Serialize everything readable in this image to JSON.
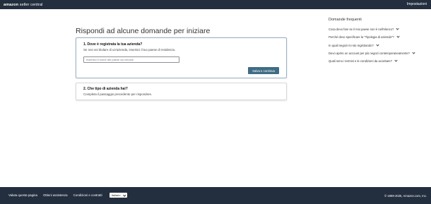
{
  "header": {
    "logo_brand": "amazon",
    "logo_product": "seller central",
    "settings_label": "Impostazioni"
  },
  "main": {
    "title": "Rispondi ad alcune domande per iniziare",
    "step1": {
      "title": "1. Dove è registrata la tua azienda?",
      "subtitle": "Se non sei titolare di un'azienda, inserisci il tuo paese di residenza.",
      "input_placeholder": "Inserisci il nome del paese da cercare",
      "input_value": "",
      "button_label": "Salva e continua"
    },
    "step2": {
      "title": "2. Che tipo di azienda hai?",
      "subtitle": "Completa il passaggio precedente per rispondere."
    }
  },
  "faq": {
    "title": "Domande frequenti",
    "items": [
      {
        "label": "Cosa devo fare se il mio paese non è nell'elenco?"
      },
      {
        "label": "Perché devo specificare la \"Tipologia di azienda\"?"
      },
      {
        "label": "In quali negozi mi sto registrando?"
      },
      {
        "label": "Devo aprire un account per più negozi contemporaneamente?"
      },
      {
        "label": "Quali sono i termini e le condizioni da accettare?"
      }
    ]
  },
  "footer": {
    "links": [
      {
        "label": "Valuta questa pagina"
      },
      {
        "label": "Ottieni assistenza"
      },
      {
        "label": "Condizioni e contratti"
      }
    ],
    "language_selected": "Italiano",
    "copyright": "© 1999-2025, Amazon.com, Inc."
  },
  "colors": {
    "topbar_bg": "#232f3e",
    "button_bg": "#3f6c84",
    "active_card_border": "#9bb3c6"
  }
}
